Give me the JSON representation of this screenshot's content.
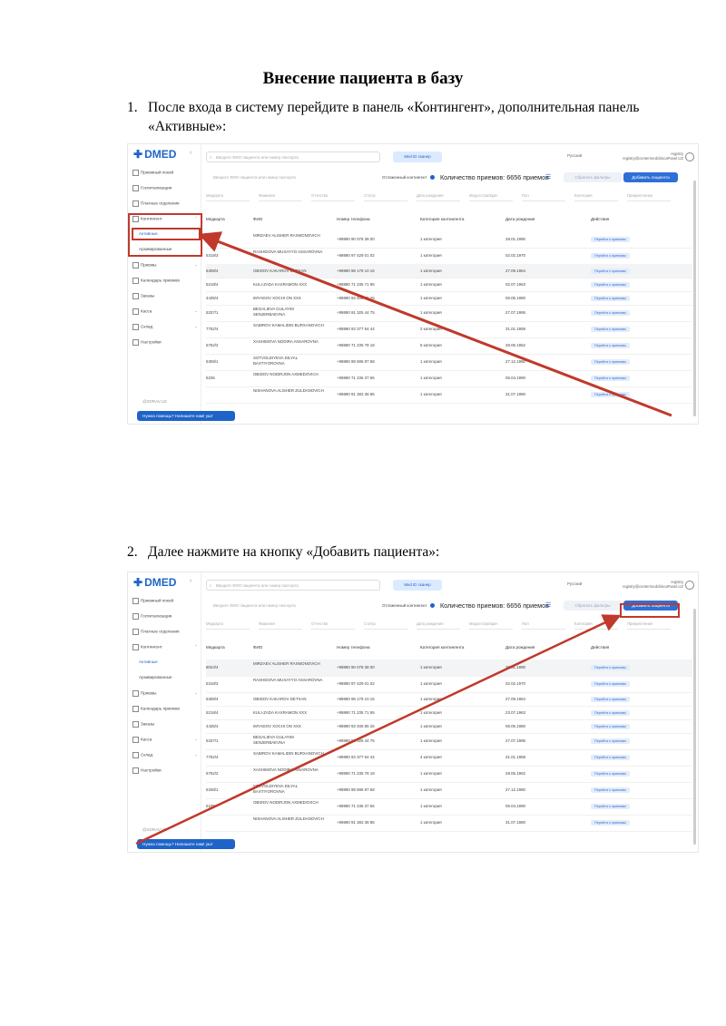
{
  "doc": {
    "title": "Внесение пациента в базу",
    "step1_num": "1.",
    "step1_text": "После входа в систему перейдите в панель «Контингент», дополнительная панель «Активные»:",
    "step2_num": "2.",
    "step2_text": "Далее нажмите на кнопку «Добавить пациента»:"
  },
  "app": {
    "logo": "DMED",
    "search_placeholder": "Введите ФИО пациента или номер паспорта",
    "med_id": "Med ID сканер",
    "language": "Русский",
    "user_line1": "registry",
    "user_line2": "registry@centermedclinicaPanel.UZ",
    "search2_placeholder": "Введите ФИО пациента или номер паспорта",
    "online_label": "Отложенный контингент",
    "count_text": "Количество приемов: 6656 приемов",
    "reset_label": "Сбросить фильтры",
    "add_patient": "Добавить пациента",
    "filters": [
      "Медкарта",
      "Фамилия",
      "Отчество",
      "Статус",
      "Дата рождения",
      "Медсестра/врач",
      "Пол",
      "Категория",
      "Прикрепление"
    ],
    "columns": [
      "Медкарта",
      "ФИО",
      "Номер телефона",
      "Категория контингента",
      "Дата рождения",
      "Действия"
    ],
    "menu": [
      {
        "label": "Приемный покой",
        "chev": ""
      },
      {
        "label": "Госпитализация",
        "chev": ""
      },
      {
        "label": "Платные отделения",
        "chev": ""
      },
      {
        "label": "Контингент",
        "chev": "⌃"
      },
      {
        "label": "Активные",
        "chev": "",
        "sub": true,
        "active": true
      },
      {
        "label": "Архивированные",
        "chev": "",
        "sub": true
      },
      {
        "label": "Приемы",
        "chev": "⌄"
      },
      {
        "label": "Календарь приемов",
        "chev": ""
      },
      {
        "label": "Заказы",
        "chev": ""
      },
      {
        "label": "Касса",
        "chev": "⌄"
      },
      {
        "label": "Склад",
        "chev": "⌄"
      },
      {
        "label": "Настройки",
        "chev": ""
      }
    ],
    "footer": "@ZDRAV.UZ",
    "help": "Нужна помощь? Напишите нам!   ушт",
    "action_btn": "Перейти к приемам",
    "rows_shot1": [
      [
        "8024/4",
        "MIRZAEV ALISHER RAXMONOVICH",
        "+99890 90 078 38 00",
        "1 категория",
        "28.01.1990"
      ],
      [
        "5318/3",
        "RASHIDOVA MUXAYYO ASSAROVNA",
        "+99890 97 429 01 02",
        "1 категория",
        "02.02.1970"
      ],
      [
        "5308/4",
        "OBIDOV KAKAROV DETXAN",
        "+99890 98 179 10 16",
        "1 категория",
        "27.09.1964"
      ],
      [
        "5218/4",
        "KULI-ZADA KAXRAMON XXX",
        "+99890 71 235 71 95",
        "1 категория",
        "02.07.1963"
      ],
      [
        "4435/4",
        "IMYADOV XOCHI ON XXX",
        "+99890 93 406 85 26",
        "1 категория",
        "06.05.1980"
      ],
      [
        "5337/1",
        "BEGALIEVA GULAYIM SENJERBAEVNA",
        "+99890 91 325 44 75",
        "1 категория",
        "27.07.1995"
      ],
      [
        "7752/4",
        "SABIROV KAMALIDIN BURXANOVICH",
        "+99890 93 377 64 44",
        "2 категория",
        "31.01.1958"
      ],
      [
        "5752/2",
        "XASHIMOVA NODIRA ANVAROVNA",
        "+99890 71 235 78 18",
        "5 категория",
        "28.05.1962"
      ],
      [
        "5308/1",
        "SOTVOLDIYEVA DILYAL BAXTIYOROVNA",
        "+99890 99 595 87 58",
        "1 категория",
        "27.12.1980"
      ],
      [
        "5236",
        "OBIDOV NODIRJON AXMEDOVICH",
        "+99890 71 236 37 56",
        "1 категория",
        "06.04.1990"
      ],
      [
        "",
        "NISHANOVA ALISHER ZULDANOVICH",
        "+99890 91 383 38 85",
        "1 категория",
        "31.07.1980"
      ]
    ],
    "rows_shot2": [
      [
        "8024/4",
        "MIRZAEV ALISHER RAXMONOVICH",
        "+99890 90 078 38 00",
        "1 категория",
        "28.01.1990"
      ],
      [
        "5318/3",
        "RASHIDOVA MUXAYYO ASSAROVNA",
        "+99890 97 429 01 02",
        "1 категория",
        "02.02.1970"
      ],
      [
        "5308/4",
        "OBIDOV KAKAROV DETXAN",
        "+99890 98 179 10 16",
        "1 категория",
        "27.09.1964"
      ],
      [
        "5218/4",
        "KULI-ZADA KAXRAMON XXX",
        "+99890 71 235 71 95",
        "1 категория",
        "23.07.1963"
      ],
      [
        "4435/4",
        "IMYADOV XOCHI ON XXX",
        "+99890 93 406 85 26",
        "1 категория",
        "06.05.1980"
      ],
      [
        "5337/1",
        "BEGALIEVA GULAYIM SENJERBAEVNA",
        "+99890 91 325 44 75",
        "1 категория",
        "27.07.1995"
      ],
      [
        "7752/4",
        "SABIROV KAMALIDIN BURXANOVICH",
        "+99890 93 377 64 44",
        "4 категория",
        "31.01.1958"
      ],
      [
        "5752/2",
        "XASHIMOVA NODIRA ANVAROVNA",
        "+99890 71 235 78 18",
        "1 категория",
        "28.05.1962"
      ],
      [
        "5338/1",
        "SOTVOLDIYEVA DILYAL BAXTIYOROVNA",
        "+99890 99 595 87 58",
        "1 категория",
        "27.12.1980"
      ],
      [
        "5235",
        "OBIDOV NODIRJON AXMEDOVICH",
        "+99890 71 236 37 56",
        "1 категория",
        "06.04.1990"
      ],
      [
        "",
        "NISHANOVA ALISHER ZULDANOVICH",
        "+99890 91 383 38 85",
        "1 категория",
        "31.07.1980"
      ]
    ]
  }
}
